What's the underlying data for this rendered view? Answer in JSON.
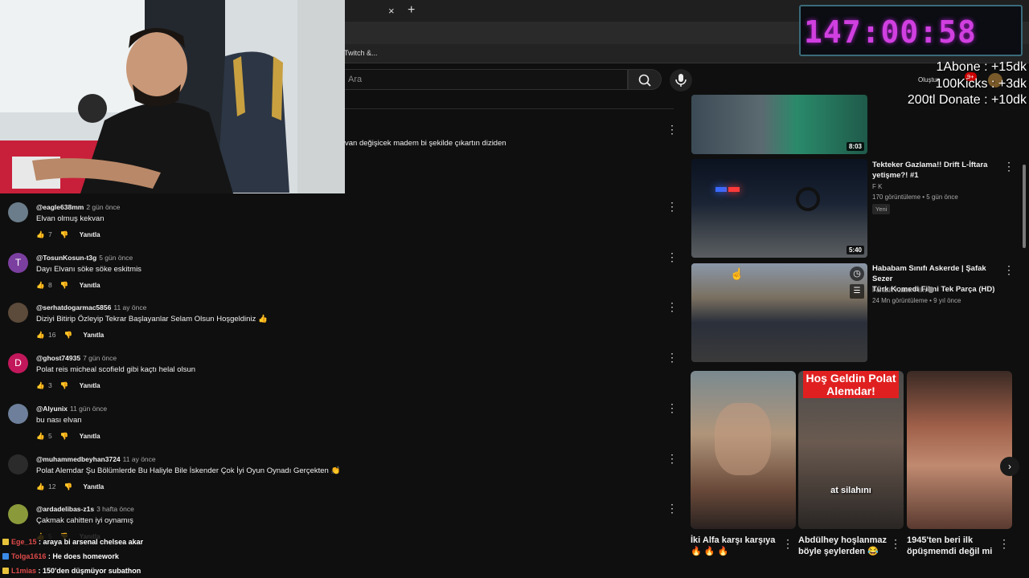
{
  "browser": {
    "tab_close": "×",
    "new_tab": "+",
    "bookmark": "Twitch &..."
  },
  "header": {
    "search_placeholder": "Ara",
    "create_label": "Oluştur",
    "notif_count": "9+"
  },
  "video_desc_snippet": "van değişicek madem bi şekilde çıkartın diziden",
  "comments": [
    {
      "handle": "@eagle638mm",
      "when": "2 gün önce",
      "text": "Elvan olmuş kekvan",
      "likes": "7",
      "avatar_letter": "",
      "avatar_color": "#6b7d8a"
    },
    {
      "handle": "@TosunKosun-t3g",
      "when": "5 gün önce",
      "text": "Dayı Elvanı söke söke eskitmis",
      "likes": "8",
      "avatar_letter": "T",
      "avatar_color": "#7b3fa0"
    },
    {
      "handle": "@serhatdogarmac5856",
      "when": "11 ay önce",
      "text": "Diziyi Bitirip Özleyip Tekrar Başlayanlar Selam Olsun Hoşgeldiniz 👍",
      "likes": "16",
      "avatar_letter": "",
      "avatar_color": "#5c4a3a"
    },
    {
      "handle": "@ghost74935",
      "when": "7 gün önce",
      "text": "Polat reis micheal scofield gibi kaçtı helal olsun",
      "likes": "3",
      "avatar_letter": "D",
      "avatar_color": "#c2185b"
    },
    {
      "handle": "@Alyunix",
      "when": "11 gün önce",
      "text": "bu nası elvan",
      "likes": "5",
      "avatar_letter": "",
      "avatar_color": "#6d7f9a"
    },
    {
      "handle": "@muhammedbeyhan3724",
      "when": "11 ay önce",
      "text": "Polat Alemdar Şu Bölümlerde Bu Haliyle Bile İskender Çok İyi Oyun Oynadı Gerçekten 👏",
      "likes": "12",
      "avatar_letter": "",
      "avatar_color": "#2b2b2b"
    },
    {
      "handle": "@ardadelibas-z1s",
      "when": "3 hafta önce",
      "text": "Çakmak cahitten iyi oynamış",
      "likes": "5",
      "avatar_letter": "",
      "avatar_color": "#8a9a3a"
    }
  ],
  "reply_label": "Yanıtla",
  "sidebar": [
    {
      "title": "",
      "channel": "",
      "meta": "",
      "duration": "8:03",
      "badge": ""
    },
    {
      "title_lines": [
        "Tekteker Gazlama!! Drift L-İftara",
        "yetişme?! #1"
      ],
      "channel": "F K",
      "meta": "170 görüntüleme • 5 gün önce",
      "duration": "5:40",
      "badge": "Yeni"
    },
    {
      "title_lines": [
        "Hababam Sınıfı Askerde | Şafak Sezer",
        "Türk Komedi Filmi Tek Parça (HD)"
      ],
      "channel": "Fanatik Klasik Film",
      "meta": "24 Mn görüntüleme • 9 yıl önce",
      "duration": "",
      "badge": ""
    }
  ],
  "shorts": [
    {
      "title_line1": "İki Alfa karşı karşıya",
      "title_line2": "🔥 🔥 🔥",
      "overlay": ""
    },
    {
      "title_line1": "Abdülhey hoşlanmaz",
      "title_line2": "böyle şeylerden 😂",
      "overlay": "Hoş Geldin Polat Alemdar!",
      "caption": "at silahını"
    },
    {
      "title_line1": "1945'ten beri ilk",
      "title_line2": "öpüşmemdi değil mi",
      "overlay": ""
    }
  ],
  "stream": {
    "timer": "147:00:58",
    "rates": [
      "1Abone : +15dk",
      "100Kicks : +3dk",
      "200tl Donate : +10dk"
    ],
    "chat": [
      {
        "user": "Ege_15",
        "msg": ": araya bi arsenal chelsea akar",
        "user_color": "#e04a4a",
        "badge_color": "#e8c33a"
      },
      {
        "user": "Tolga1616",
        "msg": ": He does homework",
        "user_color": "#e04a4a",
        "badge_color": "#3a8ae8"
      },
      {
        "user": "L1mias",
        "msg": ": 150'den düşmüyor subathon",
        "user_color": "#e04a4a",
        "badge_color": "#e8c33a"
      }
    ]
  },
  "colors": {
    "bg": "#0f0f0f",
    "accent": "#d03fe0",
    "notif": "#cc0000"
  }
}
